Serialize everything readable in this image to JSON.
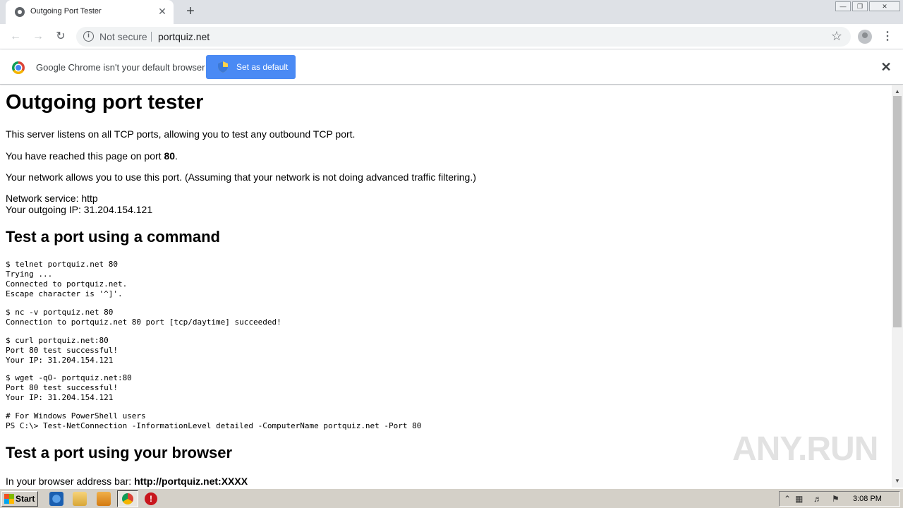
{
  "browser": {
    "tab_title": "Outgoing Port Tester",
    "tab_close": "✕",
    "new_tab": "+",
    "address": {
      "security_label": "Not secure",
      "url": "portquiz.net"
    }
  },
  "infobar": {
    "message": "Google Chrome isn't your default browser",
    "button_label": "Set as default",
    "close": "✕"
  },
  "page": {
    "title": "Outgoing port tester",
    "intro": "This server listens on all TCP ports, allowing you to test any outbound TCP port.",
    "reached_prefix": "You have reached this page on port ",
    "port": "80",
    "reached_suffix": ".",
    "allowed": "Your network allows you to use this port. (Assuming that your network is not doing advanced traffic filtering.)",
    "service": "Network service: http",
    "outgoing_ip": "Your outgoing IP: 31.204.154.121",
    "section_command": "Test a port using a command",
    "commands": [
      "$ telnet portquiz.net 80\nTrying ...\nConnected to portquiz.net.\nEscape character is '^]'.",
      "$ nc -v portquiz.net 80\nConnection to portquiz.net 80 port [tcp/daytime] succeeded!",
      "$ curl portquiz.net:80\nPort 80 test successful!\nYour IP: 31.204.154.121",
      "$ wget -qO- portquiz.net:80\nPort 80 test successful!\nYour IP: 31.204.154.121",
      "# For Windows PowerShell users\nPS C:\\> Test-NetConnection -InformationLevel detailed -ComputerName portquiz.net -Port 80"
    ],
    "section_browser": "Test a port using your browser",
    "browser_prefix": "In your browser address bar: ",
    "browser_url": "http://portquiz.net:XXXX"
  },
  "watermark": "ANY.RUN",
  "taskbar": {
    "start_label": "Start",
    "clock": "3:08 PM"
  }
}
